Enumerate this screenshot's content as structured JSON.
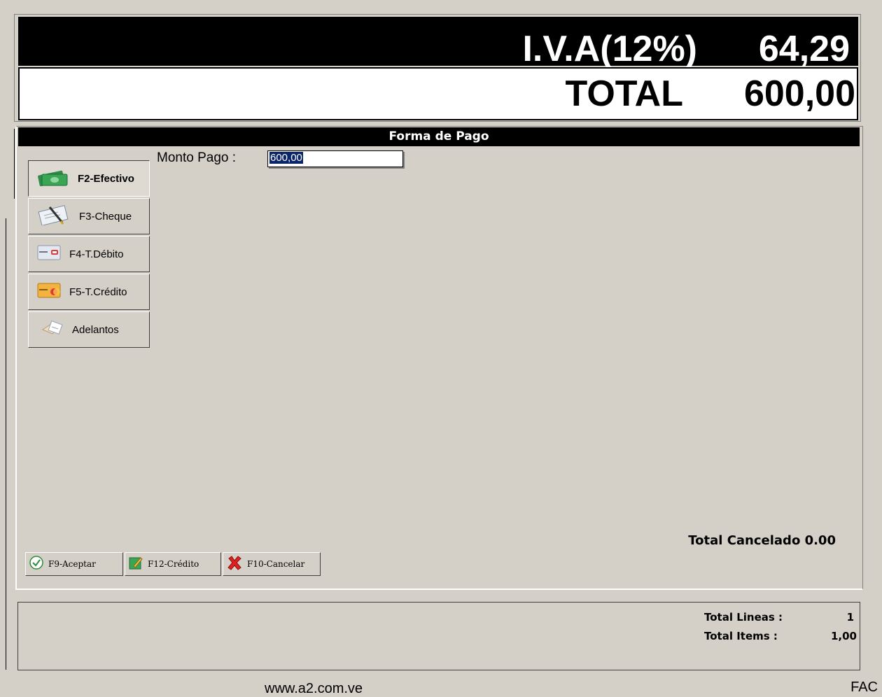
{
  "totals": {
    "iva_label": "I.V.A(12%)",
    "iva_value": "64,29",
    "total_label": "TOTAL",
    "total_value": "600,00"
  },
  "payment": {
    "header": "Forma de Pago",
    "monto_label": "Monto Pago :",
    "monto_value": "600,00",
    "methods": [
      {
        "label": "F2-Efectivo",
        "icon": "cash-icon",
        "active": true
      },
      {
        "label": "F3-Cheque",
        "icon": "check-pen-icon",
        "active": false
      },
      {
        "label": "F4-T.Débito",
        "icon": "debit-card-icon",
        "active": false
      },
      {
        "label": "F5-T.Crédito",
        "icon": "credit-card-icon",
        "active": false
      },
      {
        "label": "Adelantos",
        "icon": "advance-icon",
        "active": false
      }
    ],
    "total_cancelado": "Total Cancelado 0.00"
  },
  "actions": {
    "accept_label": "F9-Aceptar",
    "credit_label": "F12-Crédito",
    "cancel_label": "F10-Cancelar"
  },
  "status": {
    "lines_label": "Total Lineas  :",
    "lines_value": "1",
    "items_label": "Total Items :",
    "items_value": "1,00"
  },
  "footer": {
    "url": "www.a2.com.ve",
    "code": "FAC"
  },
  "colors": {
    "window_bg": "#d4d0c8",
    "header_bg": "#000000",
    "selection": "#0a246a",
    "cash_green": "#3aa655",
    "cancel_red": "#e02020"
  }
}
